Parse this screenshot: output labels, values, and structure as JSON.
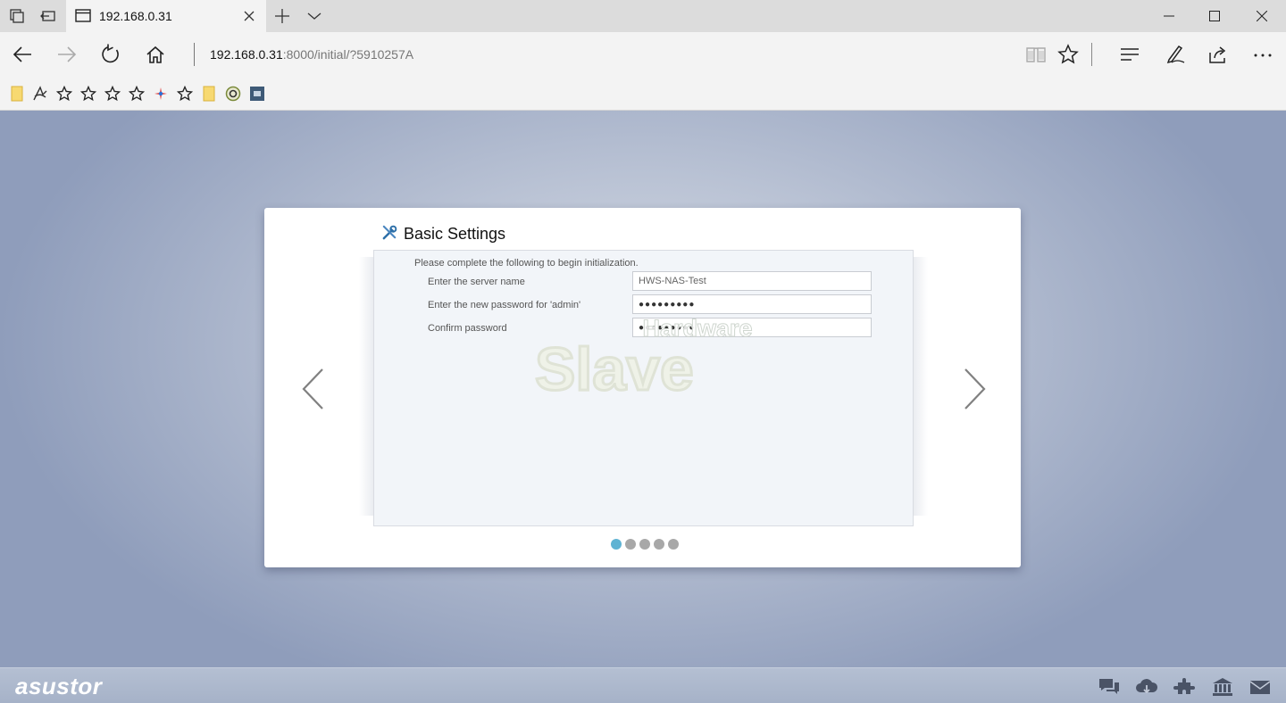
{
  "browser": {
    "tab": {
      "title": "192.168.0.31"
    },
    "address": {
      "host": "192.168.0.31",
      "rest": ":8000/initial/?5910257A"
    }
  },
  "wizard": {
    "title": "Basic Settings",
    "intro": "Please complete the following to begin initialization.",
    "fields": [
      {
        "label": "Enter the server name",
        "value": "HWS-NAS-Test"
      },
      {
        "label": "Enter the new password for 'admin'",
        "value": "●●●●●●●●●"
      },
      {
        "label": "Confirm password",
        "value": "●●●●●●●●●"
      }
    ],
    "step_count": 5,
    "active_step": 1,
    "watermark": {
      "line1": "Hardware",
      "line2": "Slave"
    }
  },
  "footer": {
    "brand": "asustor"
  },
  "colors": {
    "accent_dot": "#5fb3d3",
    "footer_bg": "#a9b5cb"
  }
}
